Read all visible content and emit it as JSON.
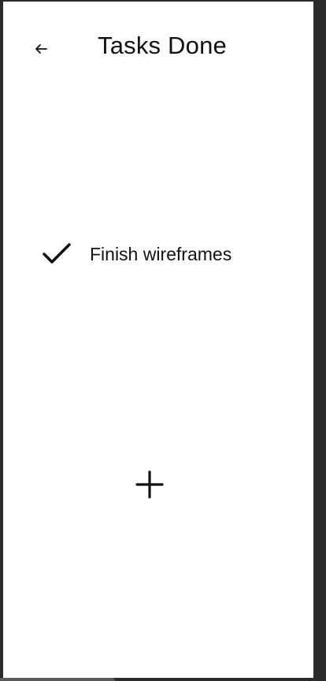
{
  "header": {
    "title": "Tasks Done",
    "back_icon": "arrow-left-icon"
  },
  "tasks": [
    {
      "label": "Finish wireframes",
      "icon": "check-icon",
      "completed": true
    }
  ],
  "actions": {
    "add_icon": "plus-icon"
  },
  "colors": {
    "background": "#ffffff",
    "text": "#111111",
    "frame": "#2b2b2b"
  }
}
